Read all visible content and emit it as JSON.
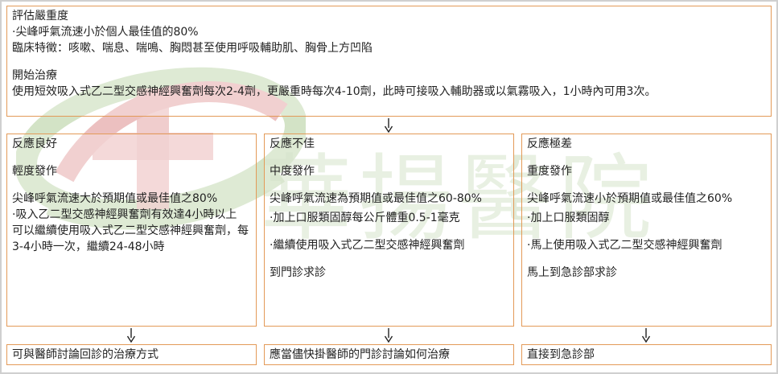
{
  "watermark": {
    "text": "華揚醫院"
  },
  "top_box": {
    "section1_title": "評估嚴重度",
    "section1_line1": "·尖峰呼氣流速小於個人最佳值的80%",
    "section1_line2": "臨床特徵：咳嗽、喘息、喘鳴、胸悶甚至使用呼吸輔助肌、胸骨上方凹陷",
    "section2_title": "開始治療",
    "section2_line1": "使用短效吸入式乙二型交感神經興奮劑每次2-4劑，更嚴重時每次4-10劑，此時可接吸入輔助器或以氣霧吸入，1小時內可用3次。"
  },
  "columns": [
    {
      "response": "反應良好",
      "severity": "輕度發作",
      "item1": "尖峰呼氣流速大於預期值或最佳值之80%",
      "item2": "·吸入乙二型交感神經興奮劑有效達4小時以上",
      "item3": "可以繼續使用吸入式乙二型交感神經興奮劑，每3-4小時一次，繼續24-48小時",
      "item4": "",
      "outcome": "可與醫師討論回診的治療方式"
    },
    {
      "response": "反應不佳",
      "severity": "中度發作",
      "item1": "尖峰呼氣流速為預期值或最佳值之60-80%",
      "item2": "·加上口服類固醇每公斤體重0.5-1毫克",
      "item3": "·繼續使用吸入式乙二型交感神經興奮劑",
      "item4": "到門診求診",
      "outcome": "應當儘快掛醫師的門診討論如何治療"
    },
    {
      "response": "反應極差",
      "severity": "重度發作",
      "item1": "尖峰呼氣流速小於預期值或最佳值之60%",
      "item2": "·加上口服類固醇",
      "item3": "·馬上使用吸入式乙二型交感神經興奮劑",
      "item4": "馬上到急診部求診",
      "outcome": "直接到急診部"
    }
  ],
  "colors": {
    "box_border": "#e39a58",
    "frame_border": "#cfcfcf",
    "arrow": "#222222",
    "logo_green": "#cfe0c0",
    "logo_red": "#e8b4b4"
  }
}
